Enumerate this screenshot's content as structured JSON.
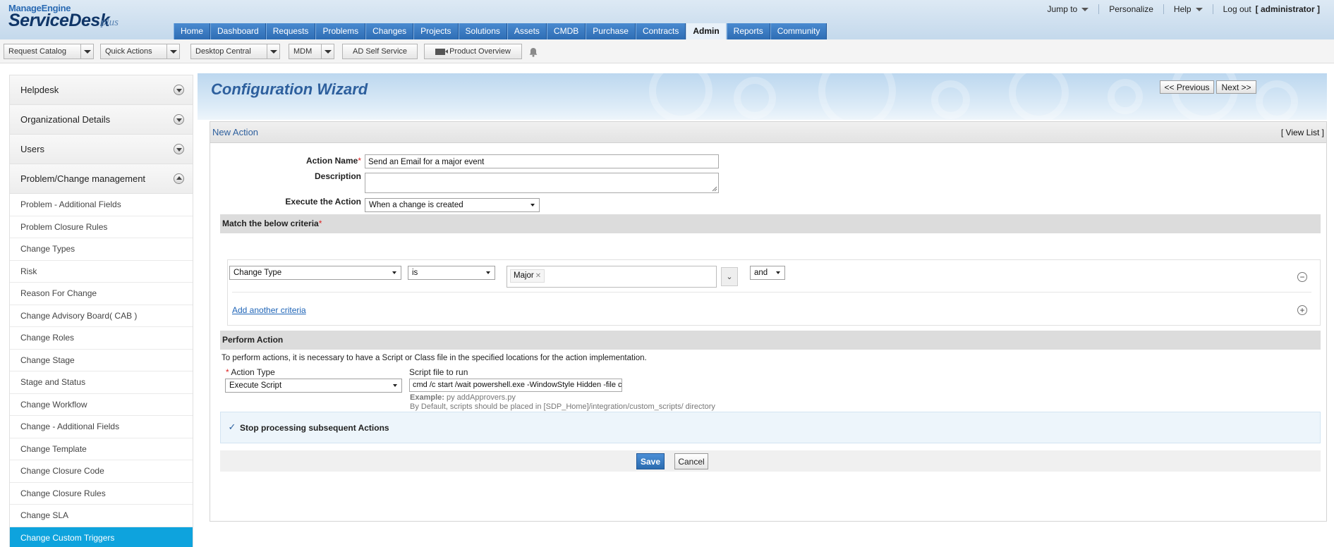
{
  "header": {
    "logo_top": "ManageEngine",
    "logo_main": "ServiceDesk",
    "logo_plus": "plus",
    "top_links": [
      "Jump to",
      "Personalize",
      "Help"
    ],
    "logout": "Log out",
    "user": "[ administrator ]",
    "tabs": [
      "Home",
      "Dashboard",
      "Requests",
      "Problems",
      "Changes",
      "Projects",
      "Solutions",
      "Assets",
      "CMDB",
      "Purchase",
      "Contracts",
      "Admin",
      "Reports",
      "Community"
    ],
    "active_tab": "Admin"
  },
  "toolbar": {
    "request_catalog": "Request Catalog",
    "quick_actions": "Quick Actions",
    "desktop_central": "Desktop Central",
    "mdm": "MDM",
    "ad_self_service": "AD Self Service",
    "product_overview": "Product Overview"
  },
  "sidebar": {
    "sections": [
      "Helpdesk",
      "Organizational Details",
      "Users",
      "Problem/Change management"
    ],
    "items": [
      "Problem - Additional Fields",
      "Problem Closure Rules",
      "Change Types",
      "Risk",
      "Reason For Change",
      "Change Advisory Board( CAB )",
      "Change Roles",
      "Change Stage",
      "Stage and Status",
      "Change Workflow",
      "Change - Additional Fields",
      "Change Template",
      "Change Closure Code",
      "Change Closure Rules",
      "Change SLA",
      "Change Custom Triggers"
    ],
    "active_item": "Change Custom Triggers"
  },
  "wizard": {
    "title": "Configuration Wizard",
    "previous": "<< Previous",
    "next": "Next >>"
  },
  "form": {
    "panel_title": "New Action",
    "view_list": "[  View List  ]",
    "action_name_label": "Action Name",
    "action_name_value": "Send an Email for a major event",
    "description_label": "Description",
    "description_value": "",
    "execute_label": "Execute the Action",
    "execute_value": "When a change is created",
    "criteria_title": "Match the below criteria",
    "criteria": {
      "field": "Change Type",
      "operator": "is",
      "value_tag": "Major",
      "conjunction": "and"
    },
    "add_criteria": "Add another criteria",
    "perform_title": "Perform Action",
    "perform_note": "To perform actions, it is necessary to have a Script or Class file in the specified locations for the action implementation.",
    "action_type_label": "Action Type",
    "action_type_value": "Execute Script",
    "script_label": "Script file to run",
    "script_value": "cmd /c start /wait powershell.exe -WindowStyle Hidden -file c:\\Mana",
    "example_label": "Example:",
    "example_value": "py addApprovers.py",
    "default_note": "By Default, scripts should be placed in [SDP_Home]/integration/custom_scripts/ directory",
    "stop_processing": "Stop processing subsequent Actions",
    "stop_checked": true,
    "save": "Save",
    "cancel": "Cancel"
  },
  "colors": {
    "tab_blue": "#2e6db4",
    "active_sidebar": "#0ea3dd",
    "title_blue": "#2d5f9d",
    "save_blue": "#2b6cb0"
  }
}
